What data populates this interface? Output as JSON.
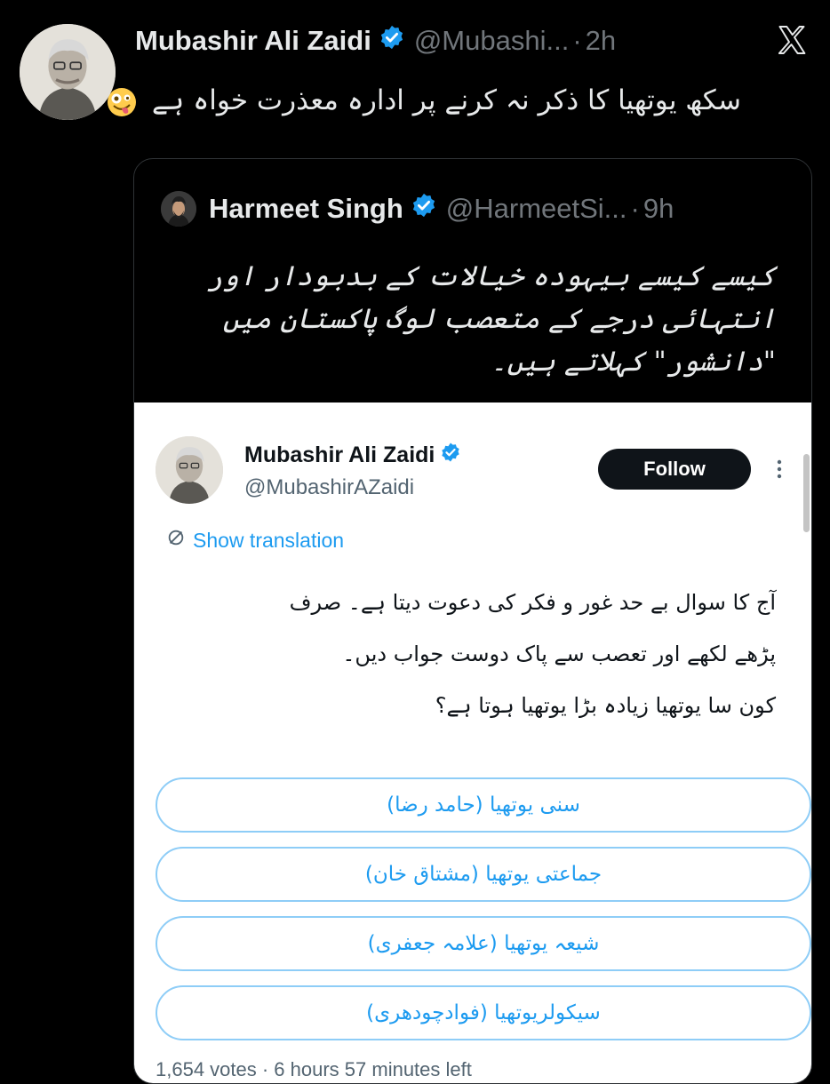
{
  "outer_tweet": {
    "author_name": "Mubashir Ali Zaidi",
    "handle": "@Mubashi...",
    "separator": "·",
    "time": "2h",
    "text": "سکھ یوتھیا کا ذکر نہ کرنے پر ادارہ معذرت خواہ ہے",
    "emoji": "zany-face-emoji"
  },
  "quoted_tweet": {
    "author_name": "Harmeet Singh",
    "handle": "@HarmeetSi...",
    "separator": "·",
    "time": "9h",
    "text": "کیسے کیسے بیہودہ خیالات کے بدبودار اور انتہائی درجے کے متعصب لوگ پاکستان میں \"دانشور\" کہلاتے ہیں۔"
  },
  "embedded_screenshot": {
    "author_name": "Mubashir Ali Zaidi",
    "handle": "@MubashirAZaidi",
    "follow_label": "Follow",
    "show_translation_label": "Show translation",
    "question_lines": [
      "آج کا سوال بے حد غور و فکر کی دعوت دیتا ہے۔ صرف",
      "پڑھے لکھے اور تعصب سے پاک دوست جواب دیں۔",
      "کون سا یوتھیا زیادہ بڑا یوتھیا ہوتا ہے؟"
    ],
    "poll_options": [
      "سنی یوتھیا (حامد رضا)",
      "جماعتی یوتھیا (مشتاق خان)",
      "شیعہ یوتھیا (علامہ جعفری)",
      "سیکولریوتھیا (فوادچودھری)"
    ],
    "poll_meta": "1,654 votes · 6 hours 57 minutes left"
  },
  "icons": {
    "verified": "verified-badge-icon",
    "x_logo": "x-logo-icon",
    "more": "more-vertical-icon",
    "translate": "translate-icon"
  },
  "colors": {
    "background": "#000000",
    "text_primary": "#e7e9ea",
    "text_secondary": "#71767b",
    "accent_blue": "#1d9bf0",
    "card_border": "#2f3336",
    "embed_background": "#ffffff"
  }
}
